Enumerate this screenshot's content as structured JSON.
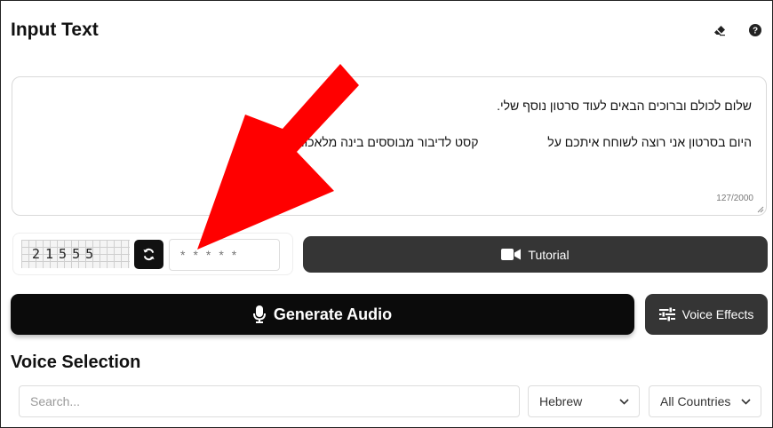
{
  "header": {
    "title": "Input Text"
  },
  "icons": {
    "clear": "eraser-icon",
    "help": "help-circle-icon",
    "refresh": "refresh-icon",
    "tutorial": "video-camera-icon",
    "generate": "microphone-icon",
    "effects": "sliders-icon"
  },
  "input_text": {
    "line1": "שלום לכולם וברוכים הבאים לעוד סרטון נוסף שלי.",
    "line2": "היום בסרטון אני רוצה לשוחח איתכם על",
    "line2_end": "קסט לדיבור מבוססים בינה מלאכותית",
    "char_count": "127/2000"
  },
  "captcha": {
    "code": "21555",
    "placeholder": "*****"
  },
  "buttons": {
    "tutorial": "Tutorial",
    "generate": "Generate Audio",
    "voice_effects": "Voice Effects"
  },
  "voice_selection": {
    "title": "Voice Selection",
    "search_placeholder": "Search...",
    "language": "Hebrew",
    "country": "All Countries"
  },
  "colors": {
    "arrow": "#ff0000",
    "dark_button": "#0b0b0b",
    "secondary_button": "#353535"
  }
}
